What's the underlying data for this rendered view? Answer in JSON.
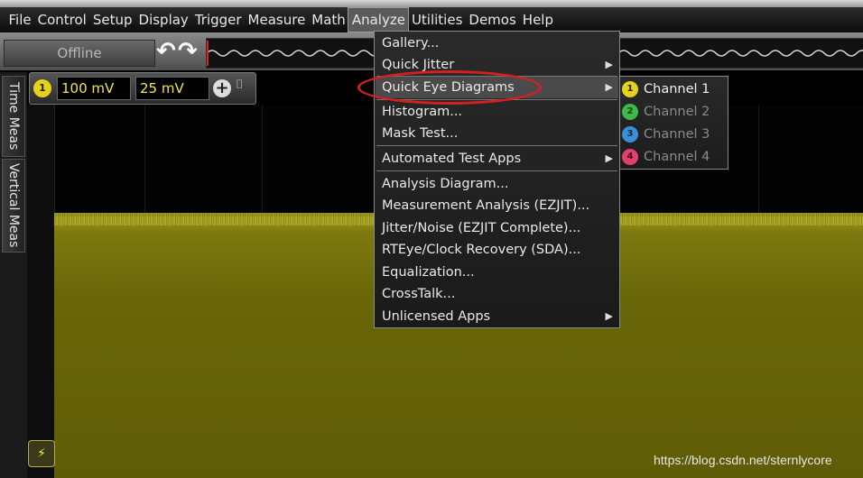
{
  "menubar": {
    "items": [
      "File",
      "Control",
      "Setup",
      "Display",
      "Trigger",
      "Measure",
      "Math",
      "Analyze",
      "Utilities",
      "Demos",
      "Help"
    ],
    "active_index": 7
  },
  "toolbar": {
    "offline_label": "Offline",
    "undo_icon": "undo-icon",
    "redo_icon": "redo-icon"
  },
  "left_tabs": {
    "time_meas": "Time Meas",
    "vertical_meas": "Vertical Meas"
  },
  "channel_bar": {
    "channel_number": "1",
    "scale_value": "100 mV",
    "offset_value": "25 mV",
    "channel_color": "#e6d21a"
  },
  "analyze_menu": {
    "items": [
      {
        "label": "Gallery...",
        "submenu": false
      },
      {
        "label": "Quick Jitter",
        "submenu": true
      },
      {
        "label": "Quick Eye Diagrams",
        "submenu": true
      },
      {
        "label": "Histogram...",
        "submenu": false
      },
      {
        "label": "Mask Test...",
        "submenu": false
      },
      {
        "label": "Automated Test Apps",
        "submenu": true
      },
      {
        "label": "Analysis Diagram...",
        "submenu": false
      },
      {
        "label": "Measurement Analysis (EZJIT)...",
        "submenu": false
      },
      {
        "label": "Jitter/Noise (EZJIT Complete)...",
        "submenu": false
      },
      {
        "label": "RTEye/Clock Recovery (SDA)...",
        "submenu": false
      },
      {
        "label": "Equalization...",
        "submenu": false
      },
      {
        "label": "CrossTalk...",
        "submenu": false
      },
      {
        "label": "Unlicensed Apps",
        "submenu": true
      }
    ],
    "highlighted_index": 2
  },
  "eye_submenu": {
    "items": [
      {
        "label": "Channel 1",
        "num": "1",
        "color": "#e6d21a",
        "enabled": true
      },
      {
        "label": "Channel 2",
        "num": "2",
        "color": "#3fb84a",
        "enabled": false
      },
      {
        "label": "Channel 3",
        "num": "3",
        "color": "#3b8fd8",
        "enabled": false
      },
      {
        "label": "Channel 4",
        "num": "4",
        "color": "#e0406a",
        "enabled": false
      }
    ]
  },
  "colors": {
    "highlight_ellipse": "#d4201f",
    "waveform": "#9c961a"
  },
  "watermark": "https://blog.csdn.net/sternlycore"
}
